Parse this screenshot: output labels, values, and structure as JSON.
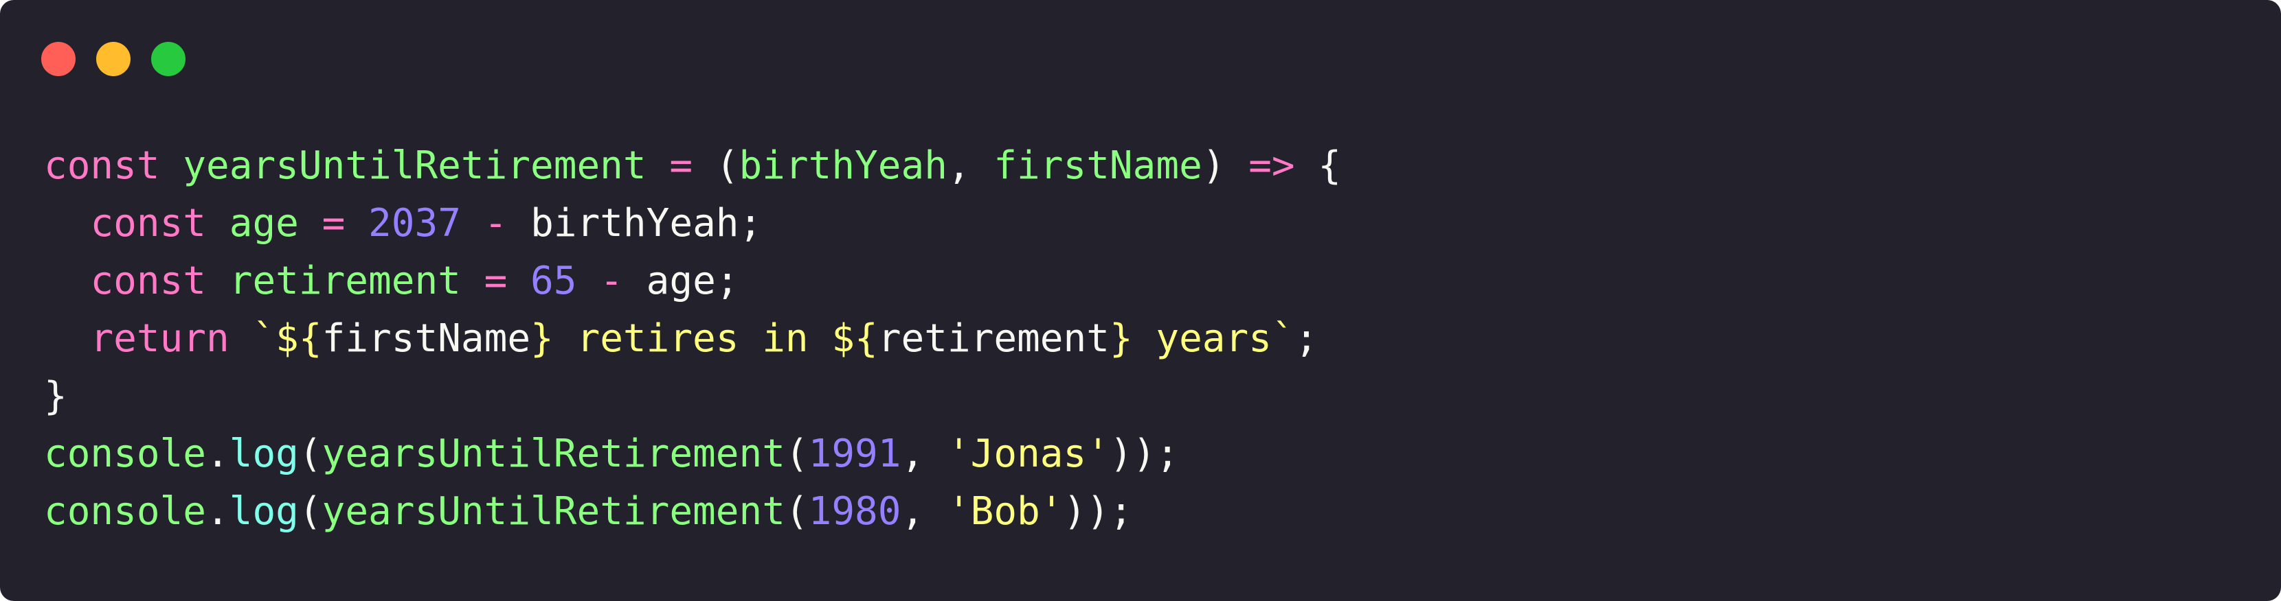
{
  "window": {
    "traffic_lights": [
      {
        "name": "close",
        "color": "#ff5f56"
      },
      {
        "name": "minimize",
        "color": "#ffbd2e"
      },
      {
        "name": "maximize",
        "color": "#27c93f"
      }
    ],
    "background": "#22212c"
  },
  "colors": {
    "keyword": "#ff79c6",
    "function": "#8aff80",
    "number": "#9580ff",
    "string": "#ffff80",
    "method": "#80ffea",
    "text": "#f8f8f2"
  },
  "code": {
    "language": "javascript",
    "lines": [
      [
        {
          "t": "kw",
          "v": "const"
        },
        {
          "t": "pun",
          "v": " "
        },
        {
          "t": "fn",
          "v": "yearsUntilRetirement"
        },
        {
          "t": "pun",
          "v": " "
        },
        {
          "t": "op",
          "v": "="
        },
        {
          "t": "pun",
          "v": " ("
        },
        {
          "t": "fn",
          "v": "birthYeah"
        },
        {
          "t": "pun",
          "v": ", "
        },
        {
          "t": "fn",
          "v": "firstName"
        },
        {
          "t": "pun",
          "v": ") "
        },
        {
          "t": "op",
          "v": "=>"
        },
        {
          "t": "pun",
          "v": " {"
        }
      ],
      [
        {
          "t": "pun",
          "v": "  "
        },
        {
          "t": "kw",
          "v": "const"
        },
        {
          "t": "pun",
          "v": " "
        },
        {
          "t": "fn",
          "v": "age"
        },
        {
          "t": "pun",
          "v": " "
        },
        {
          "t": "op",
          "v": "="
        },
        {
          "t": "pun",
          "v": " "
        },
        {
          "t": "num",
          "v": "2037"
        },
        {
          "t": "pun",
          "v": " "
        },
        {
          "t": "op",
          "v": "-"
        },
        {
          "t": "pun",
          "v": " "
        },
        {
          "t": "id",
          "v": "birthYeah"
        },
        {
          "t": "pun",
          "v": ";"
        }
      ],
      [
        {
          "t": "pun",
          "v": "  "
        },
        {
          "t": "kw",
          "v": "const"
        },
        {
          "t": "pun",
          "v": " "
        },
        {
          "t": "fn",
          "v": "retirement"
        },
        {
          "t": "pun",
          "v": " "
        },
        {
          "t": "op",
          "v": "="
        },
        {
          "t": "pun",
          "v": " "
        },
        {
          "t": "num",
          "v": "65"
        },
        {
          "t": "pun",
          "v": " "
        },
        {
          "t": "op",
          "v": "-"
        },
        {
          "t": "pun",
          "v": " "
        },
        {
          "t": "id",
          "v": "age"
        },
        {
          "t": "pun",
          "v": ";"
        }
      ],
      [
        {
          "t": "pun",
          "v": "  "
        },
        {
          "t": "kw",
          "v": "return"
        },
        {
          "t": "pun",
          "v": " "
        },
        {
          "t": "str",
          "v": "`${"
        },
        {
          "t": "id",
          "v": "firstName"
        },
        {
          "t": "str",
          "v": "} retires in ${"
        },
        {
          "t": "id",
          "v": "retirement"
        },
        {
          "t": "str",
          "v": "} years`"
        },
        {
          "t": "pun",
          "v": ";"
        }
      ],
      [
        {
          "t": "pun",
          "v": "}"
        }
      ],
      [
        {
          "t": "fn",
          "v": "console"
        },
        {
          "t": "pun",
          "v": "."
        },
        {
          "t": "meth",
          "v": "log"
        },
        {
          "t": "pun",
          "v": "("
        },
        {
          "t": "fn",
          "v": "yearsUntilRetirement"
        },
        {
          "t": "pun",
          "v": "("
        },
        {
          "t": "num",
          "v": "1991"
        },
        {
          "t": "pun",
          "v": ", "
        },
        {
          "t": "str",
          "v": "'Jonas'"
        },
        {
          "t": "pun",
          "v": "));"
        }
      ],
      [
        {
          "t": "fn",
          "v": "console"
        },
        {
          "t": "pun",
          "v": "."
        },
        {
          "t": "meth",
          "v": "log"
        },
        {
          "t": "pun",
          "v": "("
        },
        {
          "t": "fn",
          "v": "yearsUntilRetirement"
        },
        {
          "t": "pun",
          "v": "("
        },
        {
          "t": "num",
          "v": "1980"
        },
        {
          "t": "pun",
          "v": ", "
        },
        {
          "t": "str",
          "v": "'Bob'"
        },
        {
          "t": "pun",
          "v": "));"
        }
      ]
    ]
  }
}
